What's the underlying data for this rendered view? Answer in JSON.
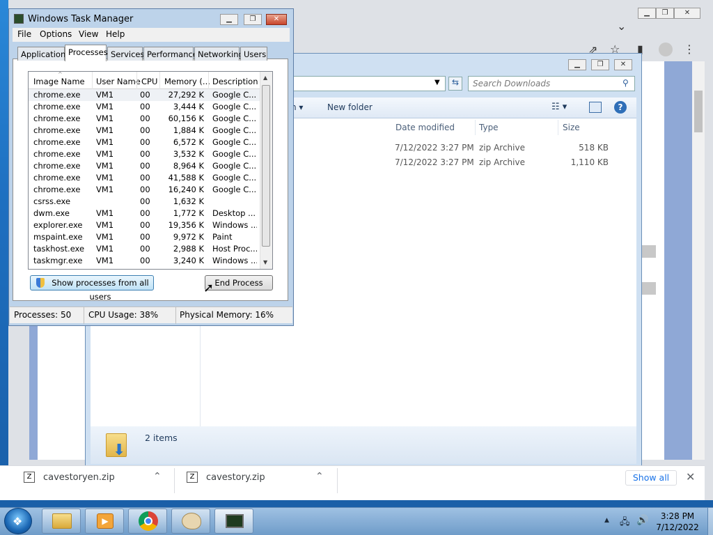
{
  "task_manager": {
    "title": "Windows Task Manager",
    "menu": [
      "File",
      "Options",
      "View",
      "Help"
    ],
    "tabs": [
      "Applications",
      "Processes",
      "Services",
      "Performance",
      "Networking",
      "Users"
    ],
    "active_tab": "Processes",
    "columns": [
      "Image Name",
      "User Name",
      "CPU",
      "Memory (...",
      "Description"
    ],
    "processes": [
      {
        "name": "chrome.exe",
        "user": "VM1",
        "cpu": "00",
        "memory": "27,292 K",
        "description": "Google C..."
      },
      {
        "name": "chrome.exe",
        "user": "VM1",
        "cpu": "00",
        "memory": "3,444 K",
        "description": "Google C..."
      },
      {
        "name": "chrome.exe",
        "user": "VM1",
        "cpu": "00",
        "memory": "60,156 K",
        "description": "Google C..."
      },
      {
        "name": "chrome.exe",
        "user": "VM1",
        "cpu": "00",
        "memory": "1,884 K",
        "description": "Google C..."
      },
      {
        "name": "chrome.exe",
        "user": "VM1",
        "cpu": "00",
        "memory": "6,572 K",
        "description": "Google C..."
      },
      {
        "name": "chrome.exe",
        "user": "VM1",
        "cpu": "00",
        "memory": "3,532 K",
        "description": "Google C..."
      },
      {
        "name": "chrome.exe",
        "user": "VM1",
        "cpu": "00",
        "memory": "8,964 K",
        "description": "Google C..."
      },
      {
        "name": "chrome.exe",
        "user": "VM1",
        "cpu": "00",
        "memory": "41,588 K",
        "description": "Google C..."
      },
      {
        "name": "chrome.exe",
        "user": "VM1",
        "cpu": "00",
        "memory": "16,240 K",
        "description": "Google C..."
      },
      {
        "name": "csrss.exe",
        "user": "",
        "cpu": "00",
        "memory": "1,632 K",
        "description": ""
      },
      {
        "name": "dwm.exe",
        "user": "VM1",
        "cpu": "00",
        "memory": "1,772 K",
        "description": "Desktop ..."
      },
      {
        "name": "explorer.exe",
        "user": "VM1",
        "cpu": "00",
        "memory": "19,356 K",
        "description": "Windows ..."
      },
      {
        "name": "mspaint.exe",
        "user": "VM1",
        "cpu": "00",
        "memory": "9,972 K",
        "description": "Paint"
      },
      {
        "name": "taskhost.exe",
        "user": "VM1",
        "cpu": "00",
        "memory": "2,988 K",
        "description": "Host Proc..."
      },
      {
        "name": "taskmgr.exe",
        "user": "VM1",
        "cpu": "00",
        "memory": "3,240 K",
        "description": "Windows ..."
      }
    ],
    "show_all_label": "Show processes from all users",
    "end_process_label": "End Process",
    "status": {
      "processes": "Processes: 50",
      "cpu": "CPU Usage: 38%",
      "memory": "Physical Memory: 16%"
    }
  },
  "explorer": {
    "search_placeholder": "Search Downloads",
    "toolbar_new_folder": "New folder",
    "columns": [
      "Date modified",
      "Type",
      "Size"
    ],
    "files": [
      {
        "date": "7/12/2022 3:27 PM",
        "type": "zip Archive",
        "size": "518 KB"
      },
      {
        "date": "7/12/2022 3:27 PM",
        "type": "zip Archive",
        "size": "1,110 KB"
      }
    ],
    "status_text": "2 items"
  },
  "downloads_shelf": {
    "items": [
      "cavestoryen.zip",
      "cavestory.zip"
    ],
    "show_all": "Show all"
  },
  "taskbar": {
    "time": "3:28 PM",
    "date": "7/12/2022"
  }
}
